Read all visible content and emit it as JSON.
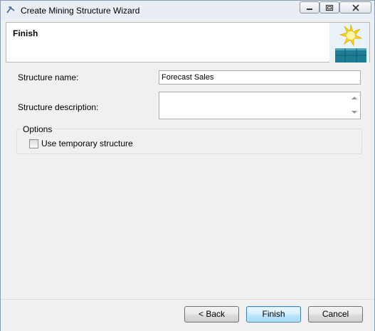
{
  "window": {
    "title": "Create Mining Structure Wizard",
    "icons": {
      "app": "mining-wizard-icon",
      "minimize": "minimize-icon",
      "maximize": "maximize-icon",
      "close": "close-icon"
    }
  },
  "header": {
    "title": "Finish",
    "graphic": "wizard-sun-cube-icon"
  },
  "form": {
    "structure_name_label": "Structure name:",
    "structure_name_value": "Forecast Sales",
    "structure_description_label": "Structure description:",
    "structure_description_value": "",
    "options_label": "Options",
    "use_temporary_label": "Use temporary structure",
    "use_temporary_checked": false
  },
  "buttons": {
    "back": "< Back",
    "finish": "Finish",
    "cancel": "Cancel"
  },
  "colors": {
    "accent_button_border": "#3c7fb1",
    "titlebar": "#e9eef5"
  }
}
